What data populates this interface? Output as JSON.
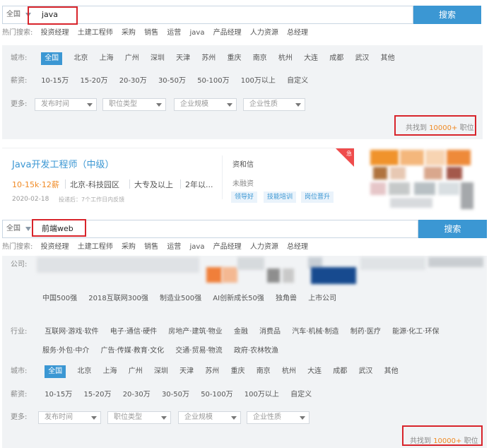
{
  "search1": {
    "city": "全国",
    "query": "java",
    "button": "搜索"
  },
  "hot1": {
    "label": "热门搜索:",
    "items": [
      "投资经理",
      "土建工程师",
      "采购",
      "销售",
      "运营",
      "java",
      "产品经理",
      "人力资源",
      "总经理"
    ]
  },
  "filters1": {
    "city_label": "城市:",
    "cities": [
      "全国",
      "北京",
      "上海",
      "广州",
      "深圳",
      "天津",
      "苏州",
      "重庆",
      "南京",
      "杭州",
      "大连",
      "成都",
      "武汉",
      "其他"
    ],
    "salary_label": "薪资:",
    "salaries": [
      "10-15万",
      "15-20万",
      "20-30万",
      "30-50万",
      "50-100万",
      "100万以上",
      "自定义"
    ],
    "more_label": "更多:",
    "selects": [
      "发布时间",
      "职位类型",
      "企业规模",
      "企业性质"
    ],
    "found_prefix": "共找到",
    "found_count": "10000+",
    "found_suffix": "职位"
  },
  "job": {
    "title": "Java开发工程师（中级）",
    "salary": "10-15k·12薪",
    "location": "北京-科技园区",
    "education": "大专及以上",
    "experience": "2年以...",
    "date": "2020-02-18",
    "feedback": "投递后：7个工作日内反馈",
    "company": "资和信",
    "funding": "未融资",
    "tags": [
      "领导好",
      "技能培训",
      "岗位晋升"
    ],
    "badge": "急"
  },
  "search2": {
    "city": "全国",
    "query": "前端web",
    "button": "搜索"
  },
  "hot2": {
    "label": "热门搜索:",
    "items": [
      "投资经理",
      "土建工程师",
      "采购",
      "销售",
      "运营",
      "java",
      "产品经理",
      "人力资源",
      "总经理"
    ]
  },
  "filters2": {
    "company_label": "公司:",
    "company_types": [
      "中国500强",
      "2018互联网300强",
      "制造业500强",
      "AI创新成长50强",
      "独角兽",
      "上市公司"
    ],
    "industry_label": "行业:",
    "industries_row1": [
      "互联网·游戏·软件",
      "电子·通信·硬件",
      "房地产·建筑·物业",
      "金融",
      "消费品",
      "汽车·机械·制造",
      "制药·医疗",
      "能源·化工·环保"
    ],
    "industries_row2": [
      "服务·外包·中介",
      "广告·传媒·教育·文化",
      "交通·贸易·物流",
      "政府·农林牧渔"
    ],
    "city_label": "城市:",
    "cities": [
      "全国",
      "北京",
      "上海",
      "广州",
      "深圳",
      "天津",
      "苏州",
      "重庆",
      "南京",
      "杭州",
      "大连",
      "成都",
      "武汉",
      "其他"
    ],
    "salary_label": "薪资:",
    "salaries": [
      "10-15万",
      "15-20万",
      "20-30万",
      "30-50万",
      "50-100万",
      "100万以上",
      "自定义"
    ],
    "more_label": "更多:",
    "selects": [
      "发布时间",
      "职位类型",
      "企业规模",
      "企业性质"
    ],
    "found_prefix": "共找到",
    "found_count": "10000+",
    "found_suffix": "职位"
  },
  "colors": {
    "accent": "#3b97d3",
    "orange": "#f08a24",
    "highlight_box": "#d8242b"
  }
}
